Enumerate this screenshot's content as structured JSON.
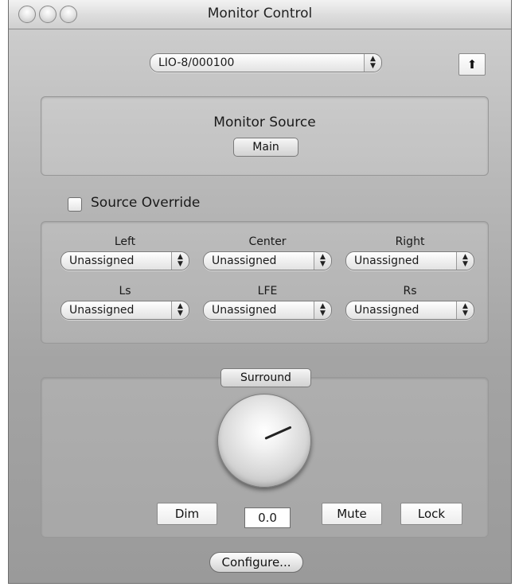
{
  "window": {
    "title": "Monitor Control"
  },
  "device": {
    "selected": "LIO-8/000100",
    "arrows": "▲▼"
  },
  "up_button": {
    "label": "⬆"
  },
  "monitor_source": {
    "heading": "Monitor Source",
    "button_label": "Main"
  },
  "source_override": {
    "label": "Source Override",
    "checked": false
  },
  "channels": [
    {
      "label": "Left",
      "value": "Unassigned"
    },
    {
      "label": "Center",
      "value": "Unassigned"
    },
    {
      "label": "Right",
      "value": "Unassigned"
    },
    {
      "label": "Ls",
      "value": "Unassigned"
    },
    {
      "label": "LFE",
      "value": "Unassigned"
    },
    {
      "label": "Rs",
      "value": "Unassigned"
    }
  ],
  "output": {
    "mode_label": "Surround",
    "level_value": "0.0",
    "dim_label": "Dim",
    "mute_label": "Mute",
    "lock_label": "Lock"
  },
  "configure_label": "Configure..."
}
